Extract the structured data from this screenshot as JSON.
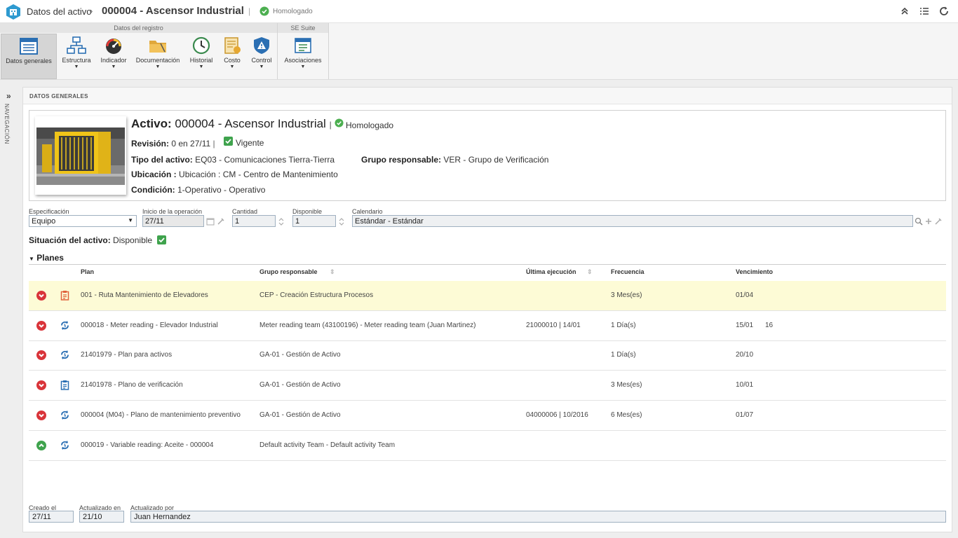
{
  "header": {
    "section": "Datos del activo",
    "title": "000004 - Ascensor Industrial",
    "badge": "Homologado"
  },
  "ribbon": {
    "group1_title": "Datos del registro",
    "group2_title": "SE Suite",
    "buttons": [
      {
        "label": "Datos generales"
      },
      {
        "label": "Estructura"
      },
      {
        "label": "Indicador"
      },
      {
        "label": "Documentación"
      },
      {
        "label": "Historial"
      },
      {
        "label": "Costo"
      },
      {
        "label": "Control"
      },
      {
        "label": "Asociaciones"
      }
    ]
  },
  "nav": {
    "label": "NAVEGACIÓN"
  },
  "main": {
    "section_title": "DATOS GENERALES"
  },
  "card": {
    "title_label": "Activo:",
    "title_value": "000004 - Ascensor Industrial",
    "badge": "Homologado",
    "revision_label": "Revisión:",
    "revision_value": "0 en 27/11",
    "revision_status": "Vigente",
    "tipo_label": "Tipo del activo:",
    "tipo_value": "EQ03 - Comunicaciones Tierra-Tierra",
    "grupo_label": "Grupo responsable:",
    "grupo_value": "VER - Grupo de Verificación",
    "ubicacion_label": "Ubicación :",
    "ubicacion_value": "Ubicación : CM - Centro de Mantenimiento",
    "condicion_label": "Condición:",
    "condicion_value": "1-Operativo - Operativo"
  },
  "fields": {
    "especificacion_label": "Especificación",
    "especificacion_value": "Equipo",
    "inicio_label": "Inicio de la operación",
    "inicio_value": "27/11",
    "cantidad_label": "Cantidad",
    "cantidad_value": "1",
    "disponible_label": "Disponible",
    "disponible_value": "1",
    "calendario_label": "Calendario",
    "calendario_value": "Estándar - Estándar"
  },
  "situacion": {
    "label": "Situación del activo:",
    "value": "Disponible"
  },
  "planes": {
    "title": "Planes",
    "columns": {
      "plan": "Plan",
      "grupo": "Grupo responsable",
      "ultima": "Última ejecución",
      "frecuencia": "Frecuencia",
      "vencimiento": "Vencimiento"
    },
    "rows": [
      {
        "status": "down",
        "type": "clipboard-red",
        "plan": "001 - Ruta Mantenimiento de Elevadores",
        "grupo": "CEP - Creación Estructura Procesos",
        "ultima": "",
        "frecuencia": "3 Mes(es)",
        "vencimiento": "01/04",
        "extra": ""
      },
      {
        "status": "down",
        "type": "cycle",
        "plan": "000018 - Meter reading - Elevador Industrial",
        "grupo": "Meter reading team (43100196) - Meter reading team (Juan Martinez)",
        "ultima": "21000010 | 14/01",
        "frecuencia": "1 Día(s)",
        "vencimiento": "15/01",
        "extra": "16"
      },
      {
        "status": "down",
        "type": "cycle",
        "plan": "21401979 - Plan para activos",
        "grupo": "GA-01 - Gestión de Activo",
        "ultima": "",
        "frecuencia": "1 Día(s)",
        "vencimiento": "20/10",
        "extra": ""
      },
      {
        "status": "down",
        "type": "clipboard-blue",
        "plan": "21401978 - Plano de verificación",
        "grupo": "GA-01 - Gestión de Activo",
        "ultima": "",
        "frecuencia": "3 Mes(es)",
        "vencimiento": "10/01",
        "extra": ""
      },
      {
        "status": "down",
        "type": "cycle",
        "plan": "000004 (M04) - Plano de mantenimiento preventivo",
        "grupo": "GA-01 - Gestión de Activo",
        "ultima": "04000006 | 10/2016",
        "frecuencia": "6 Mes(es)",
        "vencimiento": "01/07",
        "extra": ""
      },
      {
        "status": "up",
        "type": "cycle",
        "plan": "000019 - Variable reading: Aceite - 000004",
        "grupo": "Default activity Team - Default activity Team",
        "ultima": "",
        "frecuencia": "",
        "vencimiento": "",
        "extra": ""
      }
    ]
  },
  "footer": {
    "creado_label": "Creado el",
    "creado_value": "27/11",
    "actualizado_label": "Actualizado en",
    "actualizado_value": "21/10",
    "por_label": "Actualizado por",
    "por_value": "Juan Hernandez"
  },
  "colors": {
    "accent_blue": "#2b6fb3",
    "status_red": "#d9343a",
    "status_green": "#3fa34d",
    "highlight_row": "#fdfbd6"
  }
}
